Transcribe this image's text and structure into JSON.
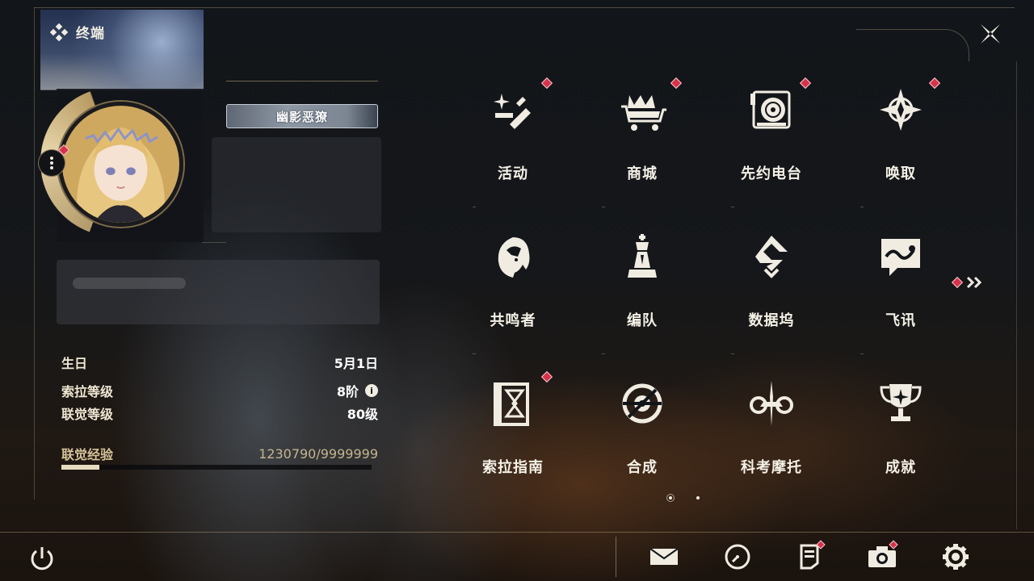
{
  "header": {
    "title": "终端",
    "accent_color": "#d6334a"
  },
  "profile": {
    "name": "幽影恶獠",
    "stats": [
      {
        "label": "生日",
        "value": "5月1日"
      },
      {
        "label": "索拉等级",
        "value": "8阶"
      },
      {
        "label": "联觉等级",
        "value": "80级"
      }
    ],
    "exp": {
      "label": "联觉经验",
      "value": "1230790/9999999",
      "progress": 0.123
    }
  },
  "menu": {
    "items": [
      {
        "label": "活动",
        "icon": "activity-sparkle-icon",
        "badge": true
      },
      {
        "label": "商城",
        "icon": "shop-cart-crown-icon",
        "badge": true
      },
      {
        "label": "先约电台",
        "icon": "radio-turntable-icon",
        "badge": true
      },
      {
        "label": "唤取",
        "icon": "compass-star-icon",
        "badge": true
      },
      {
        "label": "共鸣者",
        "icon": "resonator-head-icon",
        "badge": false
      },
      {
        "label": "编队",
        "icon": "chess-team-icon",
        "badge": false
      },
      {
        "label": "数据坞",
        "icon": "data-dock-icon",
        "badge": false
      },
      {
        "label": "飞讯",
        "icon": "chat-message-icon",
        "badge": false
      },
      {
        "label": "索拉指南",
        "icon": "guide-book-icon",
        "badge": true
      },
      {
        "label": "合成",
        "icon": "synthesis-ring-icon",
        "badge": false
      },
      {
        "label": "科考摩托",
        "icon": "motorcycle-icon",
        "badge": false
      },
      {
        "label": "成就",
        "icon": "trophy-icon",
        "badge": false
      }
    ],
    "pagination": {
      "current": 1,
      "total": 2
    }
  },
  "bottom_bar": {
    "items": [
      {
        "icon": "mail-icon",
        "badge": false
      },
      {
        "icon": "clock-icon",
        "badge": false
      },
      {
        "icon": "notice-icon",
        "badge": true
      },
      {
        "icon": "camera-icon",
        "badge": true
      },
      {
        "icon": "settings-gear-icon",
        "badge": false
      }
    ]
  }
}
